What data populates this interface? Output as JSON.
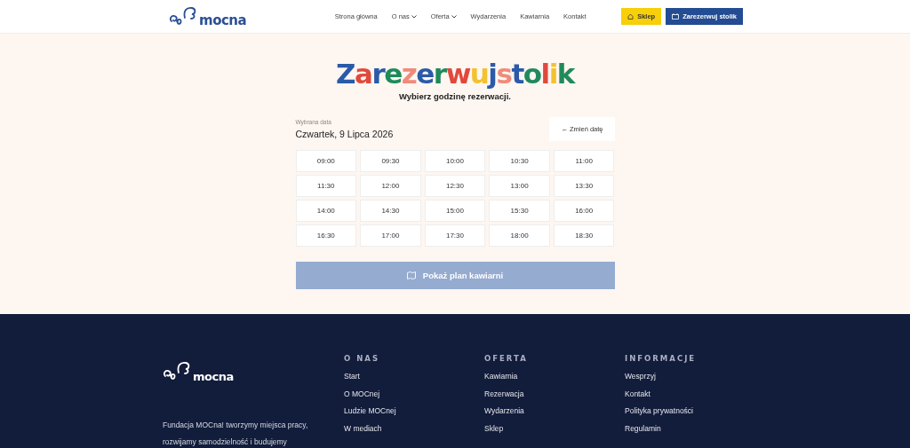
{
  "header": {
    "logo_text": "mocna",
    "nav": [
      {
        "label": "Strona główna",
        "dropdown": false
      },
      {
        "label": "O nas",
        "dropdown": true
      },
      {
        "label": "Oferta",
        "dropdown": true
      },
      {
        "label": "Wydarzenia",
        "dropdown": false
      },
      {
        "label": "Kawiarnia",
        "dropdown": false
      },
      {
        "label": "Kontakt",
        "dropdown": false
      }
    ],
    "shop_button": "Sklep",
    "reserve_button": "Zarezerwuj stolik"
  },
  "main": {
    "title_letters": [
      {
        "char": "Z",
        "color": "#2b5aa8"
      },
      {
        "char": "a",
        "color": "#e04a3c"
      },
      {
        "char": "r",
        "color": "#2b5aa8"
      },
      {
        "char": "e",
        "color": "#1f8a5a"
      },
      {
        "char": "z",
        "color": "#f08a7a"
      },
      {
        "char": "e",
        "color": "#2b5aa8"
      },
      {
        "char": "r",
        "color": "#1f8a5a"
      },
      {
        "char": "w",
        "color": "#e04a3c"
      },
      {
        "char": "u",
        "color": "#f2c230"
      },
      {
        "char": "j",
        "color": "#2b5aa8"
      },
      {
        "char": "s",
        "color": "#f08a7a"
      },
      {
        "char": "t",
        "color": "#2b5aa8"
      },
      {
        "char": "o",
        "color": "#1f8a5a"
      },
      {
        "char": "l",
        "color": "#e04a3c"
      },
      {
        "char": "i",
        "color": "#f2c230"
      },
      {
        "char": "k",
        "color": "#1f8a5a"
      }
    ],
    "subtitle": "Wybierz godzinę rezerwacji.",
    "date_label": "Wybrana data",
    "date_value": "Czwartek, 9 Lipca 2026",
    "change_date_button": "← Zmień datę",
    "slots": [
      {
        "time": "09:00",
        "selected": false
      },
      {
        "time": "09:30",
        "selected": false
      },
      {
        "time": "10:00",
        "selected": false
      },
      {
        "time": "10:30",
        "selected": false
      },
      {
        "time": "11:00",
        "selected": false
      },
      {
        "time": "11:30",
        "selected": false
      },
      {
        "time": "12:00",
        "selected": false
      },
      {
        "time": "12:30",
        "selected": false
      },
      {
        "time": "13:00",
        "selected": false
      },
      {
        "time": "13:30",
        "selected": false
      },
      {
        "time": "14:00",
        "selected": false
      },
      {
        "time": "14:30",
        "selected": false
      },
      {
        "time": "15:00",
        "selected": false
      },
      {
        "time": "15:30",
        "selected": false
      },
      {
        "time": "16:00",
        "selected": false
      },
      {
        "time": "16:30",
        "selected": false
      },
      {
        "time": "17:00",
        "selected": false
      },
      {
        "time": "17:30",
        "selected": false
      },
      {
        "time": "18:00",
        "selected": false
      },
      {
        "time": "18:30",
        "selected": false
      }
    ],
    "plan_button": {
      "label": "Pokaż plan kawiarni",
      "disabled": true
    }
  },
  "footer": {
    "logo_text": "mocna",
    "description": "Fundacja MOCna! tworzymy miejsca pracy, rozwijamy samodzielność i budujemy",
    "columns": [
      {
        "heading": "O NAS",
        "links": [
          "Start",
          "O MOCnej",
          "Ludzie MOCnej",
          "W mediach"
        ]
      },
      {
        "heading": "OFERTA",
        "links": [
          "Kawiarnia",
          "Rezerwacja",
          "Wydarzenia",
          "Sklep"
        ]
      },
      {
        "heading": "INFORMACJE",
        "links": [
          "Wesprzyj",
          "Kontakt",
          "Polityka prywatności",
          "Regulamin"
        ]
      }
    ]
  }
}
